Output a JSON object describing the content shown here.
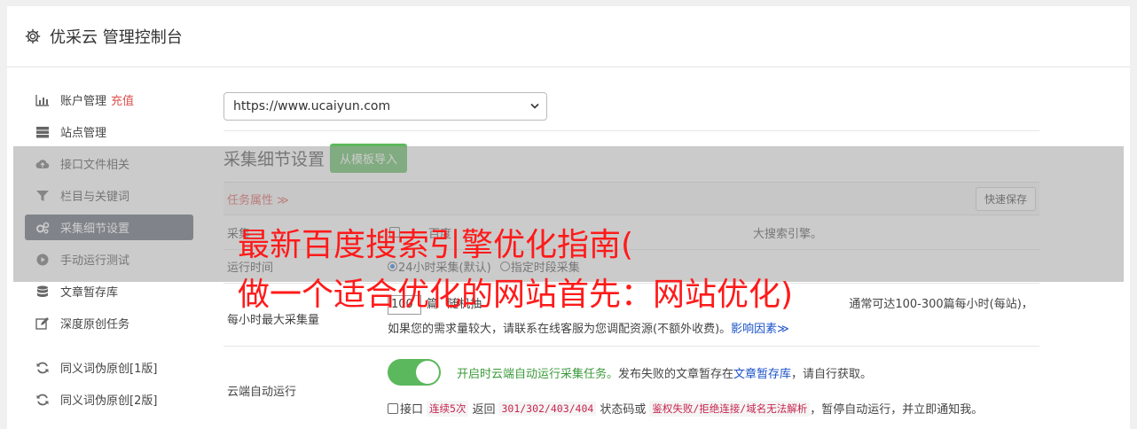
{
  "header": {
    "title": "优采云 管理控制台",
    "icon": "gear-icon"
  },
  "sidebar": {
    "items": [
      {
        "label": "账户管理",
        "badge": "充值",
        "icon": "bar-chart-icon"
      },
      {
        "label": "站点管理",
        "icon": "server-icon"
      },
      {
        "label": "接口文件相关",
        "icon": "cloud-upload-icon"
      },
      {
        "label": "栏目与关键词",
        "icon": "filter-icon"
      },
      {
        "label": "采集细节设置",
        "icon": "gears-icon",
        "active": true
      },
      {
        "label": "手动运行测试",
        "icon": "play-icon"
      },
      {
        "label": "文章暂存库",
        "icon": "database-icon"
      },
      {
        "label": "深度原创任务",
        "icon": "edit-icon"
      },
      {
        "label": "同义词伪原创[1版]",
        "icon": "refresh-icon"
      },
      {
        "label": "同义词伪原创[2版]",
        "icon": "refresh-icon"
      }
    ]
  },
  "site_select": {
    "value": "https://www.ucaiyun.com"
  },
  "section": {
    "title": "采集细节设置",
    "import_button": "从模板导入"
  },
  "task_bar": {
    "tab_label": "任务属性 ≫",
    "quick_save": "快速保存"
  },
  "rows": {
    "source": {
      "label": "采集",
      "text_start": "百度",
      "text_tail": "大搜索引擎。"
    },
    "run_time": {
      "label": "运行时间",
      "option1": "24小时采集(默认)",
      "option2": "指定时段采集"
    },
    "max_per_hour": {
      "label": "每小时最大采集量",
      "value": "100",
      "line1_head": "篇",
      "line1_mid": "随机抽",
      "line1_tail": "通常可达100-300篇每小时(每站)，",
      "line2": "如果您的需求量较大，请联系在线客服为您调配资源(不额外收费)。",
      "link": "影响因素≫"
    },
    "cloud": {
      "label": "云端自动运行",
      "desc_green": "开启时云端自动运行采集任务。",
      "desc_1": "发布失败的文章暂存在",
      "desc_link": "文章暂存库",
      "desc_2": "，请自行获取。",
      "chk_label": "接口",
      "code1": "连续5次",
      "mid1": "返回",
      "code2": "301/302/403/404",
      "mid2": "状态码或",
      "code3": "鉴权失败/拒绝连接/域名无法解析",
      "tail": "，暂停自动运行，并立即通知我。"
    }
  },
  "overlay_banner": {
    "line1": "最新百度搜索引擎优化指南(",
    "line2": "做一个适合优化的网站首先：网站优化)"
  },
  "colors": {
    "accent_green": "#5cb85c",
    "banner_red": "#ff1a1a",
    "active_nav": "#5a6270",
    "link_blue": "#1a52c9"
  }
}
